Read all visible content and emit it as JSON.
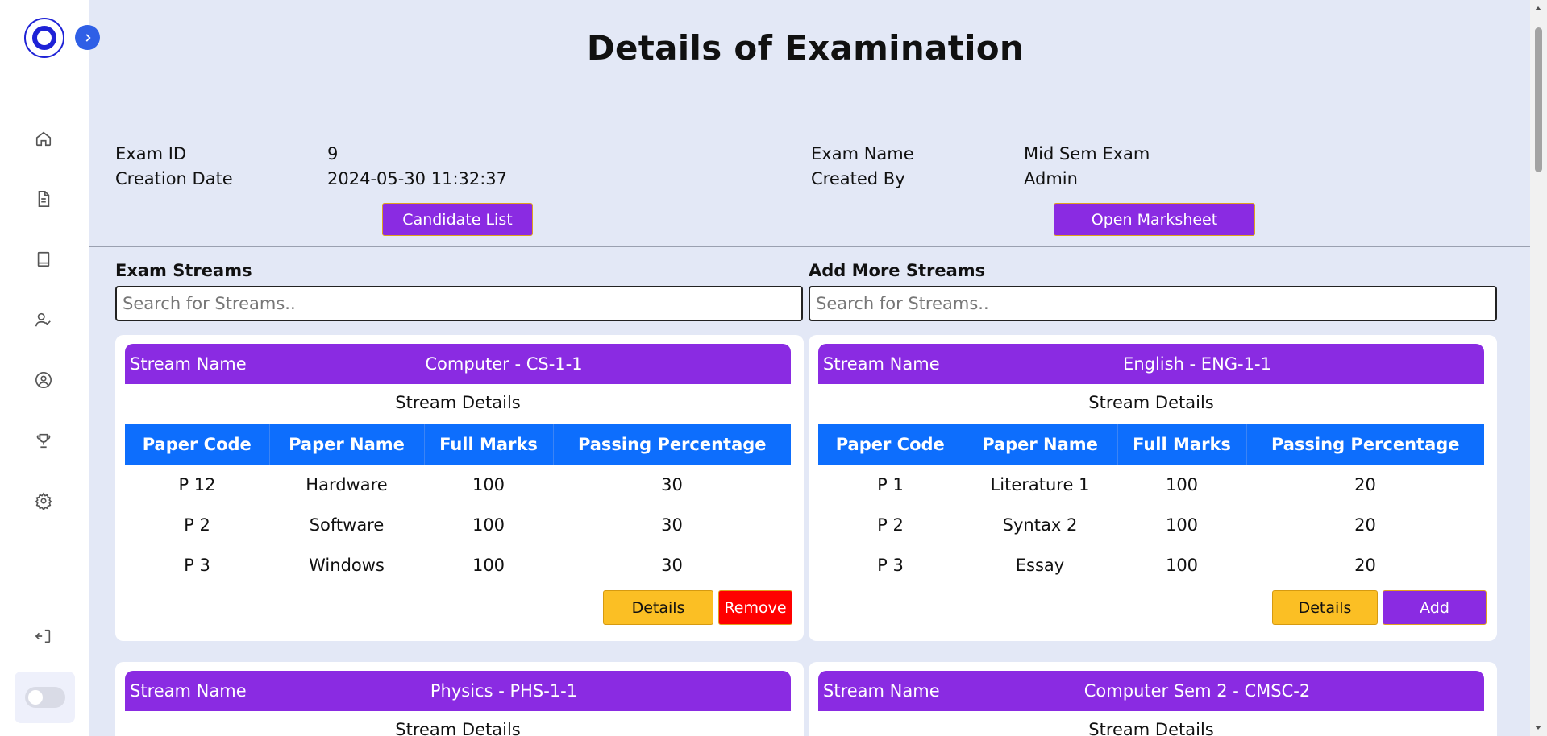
{
  "colors": {
    "accent": "#8a2be2",
    "table_header": "#0d6efd",
    "details_btn": "#fbbf24",
    "remove_btn": "#ff0000",
    "background": "#e3e8f6"
  },
  "sidebar": {
    "icons": [
      "home-icon",
      "document-icon",
      "book-icon",
      "user-check-icon",
      "user-circle-icon",
      "trophy-icon",
      "gear-icon",
      "logout-icon"
    ]
  },
  "page": {
    "title": "Details of Examination"
  },
  "exam": {
    "id_label": "Exam ID",
    "id_value": "9",
    "date_label": "Creation Date",
    "date_value": "2024-05-30 11:32:37",
    "name_label": "Exam Name",
    "name_value": "Mid Sem Exam",
    "by_label": "Created By",
    "by_value": "Admin",
    "candidate_btn": "Candidate List",
    "marksheet_btn": "Open Marksheet"
  },
  "streams": {
    "left_title": "Exam Streams",
    "right_title": "Add More Streams",
    "left_placeholder": "Search for Streams..",
    "right_placeholder": "Search for Streams.."
  },
  "table_headers": [
    "Paper Code",
    "Paper Name",
    "Full Marks",
    "Passing Percentage"
  ],
  "cards": [
    {
      "label": "Stream Name",
      "name": "Computer - CS-1-1",
      "details_title": "Stream Details",
      "rows": [
        [
          "P 12",
          "Hardware",
          "100",
          "30"
        ],
        [
          "P 2",
          "Software",
          "100",
          "30"
        ],
        [
          "P 3",
          "Windows",
          "100",
          "30"
        ]
      ],
      "btn1": "Details",
      "btn2": "Remove"
    },
    {
      "label": "Stream Name",
      "name": "English - ENG-1-1",
      "details_title": "Stream Details",
      "rows": [
        [
          "P 1",
          "Literature 1",
          "100",
          "20"
        ],
        [
          "P 2",
          "Syntax 2",
          "100",
          "20"
        ],
        [
          "P 3",
          "Essay",
          "100",
          "20"
        ]
      ],
      "btn1": "Details",
      "btn2": "Add"
    },
    {
      "label": "Stream Name",
      "name": "Physics - PHS-1-1",
      "details_title": "Stream Details"
    },
    {
      "label": "Stream Name",
      "name": "Computer Sem 2 - CMSC-2",
      "details_title": "Stream Details"
    }
  ]
}
